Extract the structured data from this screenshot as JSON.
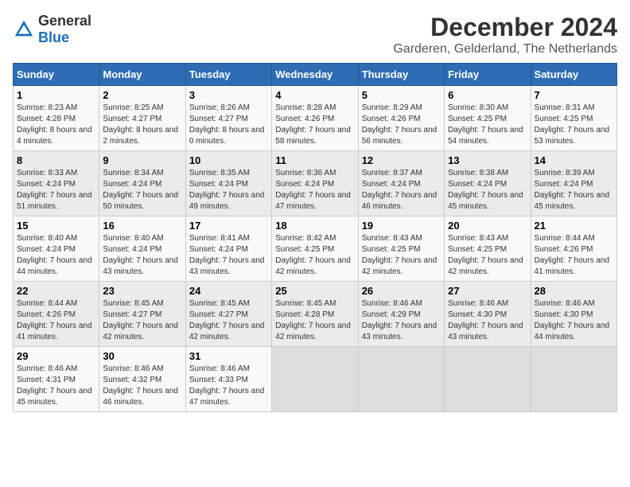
{
  "logo": {
    "general": "General",
    "blue": "Blue"
  },
  "title": "December 2024",
  "subtitle": "Garderen, Gelderland, The Netherlands",
  "headers": [
    "Sunday",
    "Monday",
    "Tuesday",
    "Wednesday",
    "Thursday",
    "Friday",
    "Saturday"
  ],
  "weeks": [
    [
      {
        "day": "1",
        "sunrise": "8:23 AM",
        "sunset": "4:28 PM",
        "daylight": "8 hours and 4 minutes."
      },
      {
        "day": "2",
        "sunrise": "8:25 AM",
        "sunset": "4:27 PM",
        "daylight": "8 hours and 2 minutes."
      },
      {
        "day": "3",
        "sunrise": "8:26 AM",
        "sunset": "4:27 PM",
        "daylight": "8 hours and 0 minutes."
      },
      {
        "day": "4",
        "sunrise": "8:28 AM",
        "sunset": "4:26 PM",
        "daylight": "7 hours and 58 minutes."
      },
      {
        "day": "5",
        "sunrise": "8:29 AM",
        "sunset": "4:26 PM",
        "daylight": "7 hours and 56 minutes."
      },
      {
        "day": "6",
        "sunrise": "8:30 AM",
        "sunset": "4:25 PM",
        "daylight": "7 hours and 54 minutes."
      },
      {
        "day": "7",
        "sunrise": "8:31 AM",
        "sunset": "4:25 PM",
        "daylight": "7 hours and 53 minutes."
      }
    ],
    [
      {
        "day": "8",
        "sunrise": "8:33 AM",
        "sunset": "4:24 PM",
        "daylight": "7 hours and 51 minutes."
      },
      {
        "day": "9",
        "sunrise": "8:34 AM",
        "sunset": "4:24 PM",
        "daylight": "7 hours and 50 minutes."
      },
      {
        "day": "10",
        "sunrise": "8:35 AM",
        "sunset": "4:24 PM",
        "daylight": "7 hours and 49 minutes."
      },
      {
        "day": "11",
        "sunrise": "8:36 AM",
        "sunset": "4:24 PM",
        "daylight": "7 hours and 47 minutes."
      },
      {
        "day": "12",
        "sunrise": "8:37 AM",
        "sunset": "4:24 PM",
        "daylight": "7 hours and 46 minutes."
      },
      {
        "day": "13",
        "sunrise": "8:38 AM",
        "sunset": "4:24 PM",
        "daylight": "7 hours and 45 minutes."
      },
      {
        "day": "14",
        "sunrise": "8:39 AM",
        "sunset": "4:24 PM",
        "daylight": "7 hours and 45 minutes."
      }
    ],
    [
      {
        "day": "15",
        "sunrise": "8:40 AM",
        "sunset": "4:24 PM",
        "daylight": "7 hours and 44 minutes."
      },
      {
        "day": "16",
        "sunrise": "8:40 AM",
        "sunset": "4:24 PM",
        "daylight": "7 hours and 43 minutes."
      },
      {
        "day": "17",
        "sunrise": "8:41 AM",
        "sunset": "4:24 PM",
        "daylight": "7 hours and 43 minutes."
      },
      {
        "day": "18",
        "sunrise": "8:42 AM",
        "sunset": "4:25 PM",
        "daylight": "7 hours and 42 minutes."
      },
      {
        "day": "19",
        "sunrise": "8:43 AM",
        "sunset": "4:25 PM",
        "daylight": "7 hours and 42 minutes."
      },
      {
        "day": "20",
        "sunrise": "8:43 AM",
        "sunset": "4:25 PM",
        "daylight": "7 hours and 42 minutes."
      },
      {
        "day": "21",
        "sunrise": "8:44 AM",
        "sunset": "4:26 PM",
        "daylight": "7 hours and 41 minutes."
      }
    ],
    [
      {
        "day": "22",
        "sunrise": "8:44 AM",
        "sunset": "4:26 PM",
        "daylight": "7 hours and 41 minutes."
      },
      {
        "day": "23",
        "sunrise": "8:45 AM",
        "sunset": "4:27 PM",
        "daylight": "7 hours and 42 minutes."
      },
      {
        "day": "24",
        "sunrise": "8:45 AM",
        "sunset": "4:27 PM",
        "daylight": "7 hours and 42 minutes."
      },
      {
        "day": "25",
        "sunrise": "8:45 AM",
        "sunset": "4:28 PM",
        "daylight": "7 hours and 42 minutes."
      },
      {
        "day": "26",
        "sunrise": "8:46 AM",
        "sunset": "4:29 PM",
        "daylight": "7 hours and 43 minutes."
      },
      {
        "day": "27",
        "sunrise": "8:46 AM",
        "sunset": "4:30 PM",
        "daylight": "7 hours and 43 minutes."
      },
      {
        "day": "28",
        "sunrise": "8:46 AM",
        "sunset": "4:30 PM",
        "daylight": "7 hours and 44 minutes."
      }
    ],
    [
      {
        "day": "29",
        "sunrise": "8:46 AM",
        "sunset": "4:31 PM",
        "daylight": "7 hours and 45 minutes."
      },
      {
        "day": "30",
        "sunrise": "8:46 AM",
        "sunset": "4:32 PM",
        "daylight": "7 hours and 46 minutes."
      },
      {
        "day": "31",
        "sunrise": "8:46 AM",
        "sunset": "4:33 PM",
        "daylight": "7 hours and 47 minutes."
      },
      null,
      null,
      null,
      null
    ]
  ]
}
